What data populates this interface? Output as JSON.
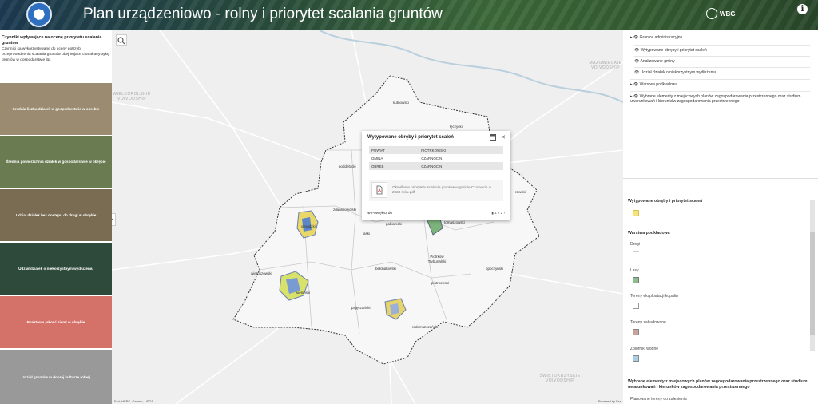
{
  "header": {
    "title": "Plan urządzeniowo - rolny i priorytet scalania gruntów",
    "brand": "WBG",
    "info_icon": "info-icon"
  },
  "left_panel": {
    "intro_title": "Czynniki wpływające na ocenę priorytetu scalania gruntów",
    "intro_text": "Czynniki są wykorzystywane do oceny potrzeb przeprowadzenia scalania gruntów obejmujące charakterystykę gruntów w gospodarstwie itp.",
    "buttons": [
      {
        "label": "Średnia liczba działek w gospodarstwie w obrębie",
        "color": "#9b8c71"
      },
      {
        "label": "Średnia powierzchnia działek w gospodarstwie w obrębie",
        "color": "#6a7b52"
      },
      {
        "label": "Udział działek bez dostępu do drogi w obrębie",
        "color": "#7a6c52"
      },
      {
        "label": "Udział działek o niekorzystnym wydłużeniu",
        "color": "#2d4a3b"
      },
      {
        "label": "Punktowa jakość ziemi w obrębie",
        "color": "#d4726a"
      },
      {
        "label": "Udział gruntów w dobrej kulturze rolnej",
        "color": "#999999"
      }
    ]
  },
  "map": {
    "labels": {
      "kutnowski": "kutnowski",
      "leczycki": "łęczycki",
      "poddebicki": "poddębicki",
      "zdunskowolski": "zduńskowolski",
      "sieradzki": "sieradzki",
      "laski": "łaski",
      "pabianicki": "pabianicki",
      "tomaszowski": "tomaszowski",
      "rawski": "rawski",
      "piotrkow": "Piotrków Trybunalski",
      "belchatowski": "bełchatowski",
      "wieruszowski": "wieruszowski",
      "wielunski": "wieluński",
      "piotrkowski": "piotrkowski",
      "opoczynski": "opoczyński",
      "pajeczanski": "pajęczański",
      "radomszczanski": "radomszczański"
    },
    "regions": {
      "mazowieckie": "MAZOWIECKIE\nVOIVODSHIP",
      "wielkopolskie": "WIELKOPOLSKIE\nVOIVODSHIP",
      "swietokrzyskie": "ŚWIĘTOKRZYSKIE\nVOIVODSHIP"
    },
    "attribution": "Esri, HERE, Garmin, USGS",
    "powered_by": "Powered by Esri"
  },
  "popup": {
    "title": "Wytypowane obręby i priorytet scaleń",
    "rows": [
      {
        "key": "POWIAT",
        "value": "PIOTRKOWSKI"
      },
      {
        "key": "GMINA",
        "value": "CZARNOCIN"
      },
      {
        "key": "OBRĘB",
        "value": "CZARNOCIN"
      }
    ],
    "file_name": "Określenie priorytetu scalania gruntów w gminie Czarnocin w 2024 roku.pdf",
    "zoom_to": "Powiększ do",
    "pagination": "1 z 2"
  },
  "layers": [
    {
      "label": "Granice administracyjne",
      "expandable": true,
      "visible": true
    },
    {
      "label": "Wytypowane obręby i priorytet scaleń",
      "expandable": false,
      "visible": true
    },
    {
      "label": "Analizowane gminy",
      "expandable": false,
      "visible": true
    },
    {
      "label": "Udział działek o niekorzystnym wydłużeniu",
      "expandable": false,
      "visible": true
    },
    {
      "label": "Warstwa podkładowa",
      "expandable": true,
      "visible": true
    },
    {
      "label": "Wybrane elementy z miejscowych planów zagospodarowania przestrzennego oraz studium uwarunkowań i kierunków zagospodarowania przestrzennego",
      "expandable": true,
      "visible": true
    }
  ],
  "legend": {
    "section1_title": "Wytypowane obręby i priorytet scaleń",
    "section2_title": "Warstwa podkładowa",
    "items": [
      {
        "label": "Drogi",
        "color": ""
      },
      {
        "label": "Lasy",
        "color": "#8fbc8f"
      },
      {
        "label": "Tereny eksploatacji kopalin",
        "color": "#ffffff"
      },
      {
        "label": "Tereny zabudowane",
        "color": "#c9a39a"
      },
      {
        "label": "Zbiorniki wodne",
        "color": "#a9cfe8"
      }
    ],
    "section3_title": "Wybrane elementy z miejscowych planów zagospodarowania przestrzennego oraz studium uwarunkowań i kierunków zagospodarowania przestrzennego",
    "section3_item": "Planowane tereny do zalesienia"
  },
  "colors": {
    "folder_swatch": "#f5e27a"
  }
}
